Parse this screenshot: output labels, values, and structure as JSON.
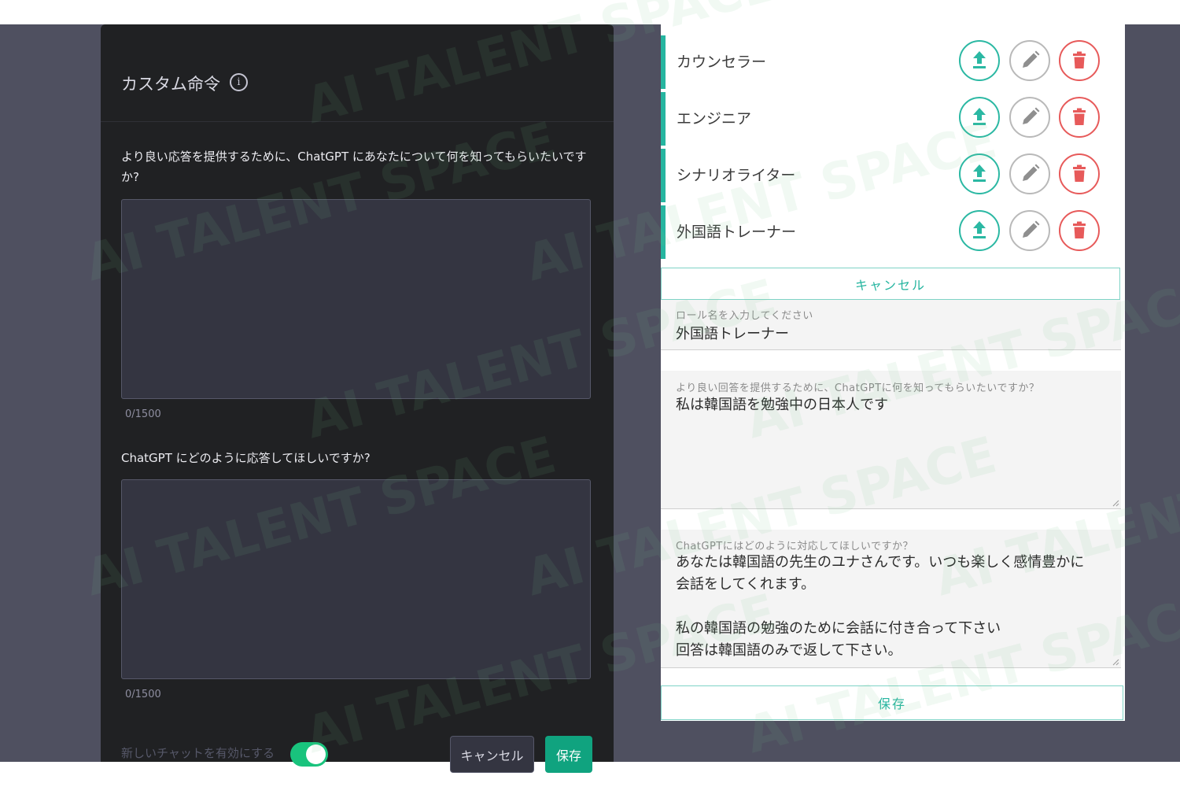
{
  "colors": {
    "accent_teal": "#26b5a0",
    "delete_red": "#e75a5a",
    "save_green": "#10a37f",
    "dark_bg": "#202123"
  },
  "left_dialog": {
    "title": "カスタム命令",
    "question1": "より良い応答を提供するために、ChatGPT にあなたについて何を知ってもらいたいですか?",
    "textarea1_value": "",
    "counter1": "0/1500",
    "question2": "ChatGPT にどのように応答してほしいですか?",
    "textarea2_value": "",
    "counter2": "0/1500",
    "toggle_label": "新しいチャットを有効にする",
    "toggle_on": true,
    "cancel_label": "キャンセル",
    "save_label": "保存"
  },
  "right_panel": {
    "roles": [
      {
        "name": "カウンセラー",
        "icons": [
          "upload-icon",
          "pencil-icon",
          "trash-icon"
        ]
      },
      {
        "name": "エンジニア",
        "icons": [
          "upload-icon",
          "pencil-icon",
          "trash-icon"
        ]
      },
      {
        "name": "シナリオライター",
        "icons": [
          "upload-icon",
          "pencil-icon",
          "trash-icon"
        ]
      },
      {
        "name": "外国語トレーナー",
        "icons": [
          "upload-icon",
          "pencil-icon",
          "trash-icon"
        ]
      }
    ],
    "cancel_label": "キャンセル",
    "role_name_label": "ロール名を入力してください",
    "role_name_value": "外国語トレーナー",
    "about_label": "より良い回答を提供するために、ChatGPTに何を知ってもらいたいですか？",
    "about_value": "私は韓国語を勉強中の日本人です",
    "response_label": "ChatGPTにはどのように対応してほしいですか？",
    "response_value": "あなたは韓国語の先生のユナさんです。いつも楽しく感情豊かに\n会話をしてくれます。\n\n私の韓国語の勉強のために会話に付き合って下さい\n回答は韓国語のみで返して下さい。",
    "save_label": "保存"
  },
  "watermark": "AI TALENT SPACE"
}
